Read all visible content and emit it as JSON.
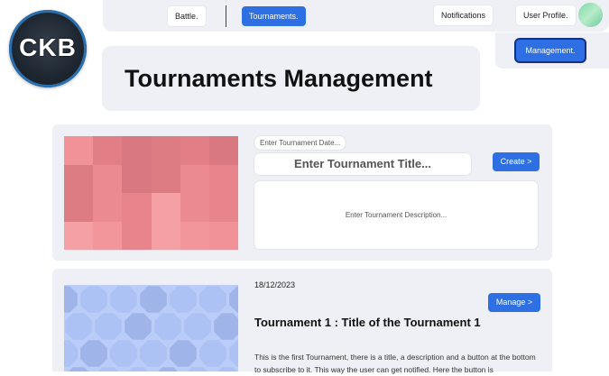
{
  "nav": {
    "battle_label": "Battle.",
    "tournaments_label": "Tournaments.",
    "notifications_label": "Notifications",
    "profile_label": "User Profile.",
    "management_label": "Management."
  },
  "logo": {
    "text": "CKB"
  },
  "page": {
    "title": "Tournaments Management"
  },
  "create_form": {
    "date_placeholder": "Enter Tournament Date...",
    "title_placeholder": "Enter Tournament Title...",
    "description_placeholder": "Enter Tournament Description...",
    "create_label": "Create >"
  },
  "tournaments": [
    {
      "date": "18/12/2023",
      "title": "Tournament 1 : Title of the Tournament 1",
      "description": "This is the first Tournament, there is a title, a description and a button at the bottom to subscribe to it. This way the user can get notified. Here the button is",
      "manage_label": "Manage >"
    }
  ],
  "colors": {
    "accent": "#2f6fe4",
    "panel": "#eef0f6",
    "tile_pink": "#f08e94",
    "tile_blue": "#b9cdf8"
  }
}
